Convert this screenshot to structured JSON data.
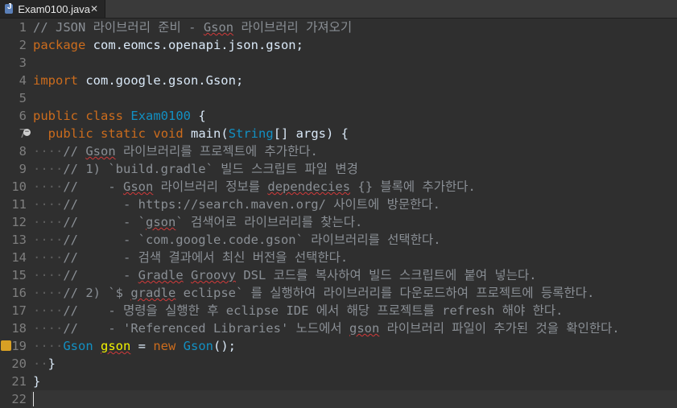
{
  "tab": {
    "title": "Exam0100.java",
    "close": "✕"
  },
  "lines": [
    {
      "n": "1",
      "segs": [
        [
          "cmt",
          "// JSON 라이브러리 준비 - "
        ],
        [
          "cmt sq",
          "Gson"
        ],
        [
          "cmt",
          " 라이브러리 가져오기"
        ]
      ]
    },
    {
      "n": "2",
      "segs": [
        [
          "kw",
          "package"
        ],
        [
          "plain",
          " com.eomcs.openapi.json.gson;"
        ]
      ]
    },
    {
      "n": "3",
      "segs": []
    },
    {
      "n": "4",
      "segs": [
        [
          "kw",
          "import"
        ],
        [
          "plain",
          " com.google.gson.Gson;"
        ]
      ]
    },
    {
      "n": "5",
      "segs": []
    },
    {
      "n": "6",
      "segs": [
        [
          "kw",
          "public"
        ],
        [
          "plain",
          " "
        ],
        [
          "kw",
          "class"
        ],
        [
          "plain",
          " "
        ],
        [
          "ty",
          "Exam0100"
        ],
        [
          "plain",
          " {"
        ]
      ]
    },
    {
      "n": "7",
      "segs": [
        [
          "plain",
          "  "
        ],
        [
          "kw",
          "public"
        ],
        [
          "plain",
          " "
        ],
        [
          "kw",
          "static"
        ],
        [
          "plain",
          " "
        ],
        [
          "kw",
          "void"
        ],
        [
          "plain",
          " main("
        ],
        [
          "ty",
          "String"
        ],
        [
          "plain",
          "[] args) {"
        ]
      ]
    },
    {
      "n": "8",
      "segs": [
        [
          "ws",
          "····"
        ],
        [
          "cmt",
          "// "
        ],
        [
          "cmt sq",
          "Gson"
        ],
        [
          "cmt",
          " 라이브러리를 프로젝트에 추가한다."
        ]
      ]
    },
    {
      "n": "9",
      "segs": [
        [
          "ws",
          "····"
        ],
        [
          "cmt",
          "// 1) `build.gradle` 빌드 스크립트 파일 변경"
        ]
      ]
    },
    {
      "n": "10",
      "segs": [
        [
          "ws",
          "····"
        ],
        [
          "cmt",
          "//    - "
        ],
        [
          "cmt sq",
          "Gson"
        ],
        [
          "cmt",
          " 라이브러리 정보를 "
        ],
        [
          "cmt sq",
          "dependecies"
        ],
        [
          "cmt",
          " {} 블록에 추가한다."
        ]
      ]
    },
    {
      "n": "11",
      "segs": [
        [
          "ws",
          "····"
        ],
        [
          "cmt",
          "//      - https://search.maven.org/ 사이트에 방문한다."
        ]
      ]
    },
    {
      "n": "12",
      "segs": [
        [
          "ws",
          "····"
        ],
        [
          "cmt",
          "//      - `"
        ],
        [
          "cmt sq",
          "gson"
        ],
        [
          "cmt",
          "` 검색어로 라이브러리를 찾는다."
        ]
      ]
    },
    {
      "n": "13",
      "segs": [
        [
          "ws",
          "····"
        ],
        [
          "cmt",
          "//      - `com.google.code.gson` 라이브러리를 선택한다."
        ]
      ]
    },
    {
      "n": "14",
      "segs": [
        [
          "ws",
          "····"
        ],
        [
          "cmt",
          "//      - 검색 결과에서 최신 버전을 선택한다."
        ]
      ]
    },
    {
      "n": "15",
      "segs": [
        [
          "ws",
          "····"
        ],
        [
          "cmt",
          "//      - "
        ],
        [
          "cmt sq",
          "Gradle"
        ],
        [
          "cmt",
          " "
        ],
        [
          "cmt sq",
          "Groovy"
        ],
        [
          "cmt",
          " DSL 코드를 복사하여 빌드 스크립트에 붙여 넣는다."
        ]
      ]
    },
    {
      "n": "16",
      "segs": [
        [
          "ws",
          "····"
        ],
        [
          "cmt",
          "// 2) `$ "
        ],
        [
          "cmt sq",
          "gradle"
        ],
        [
          "cmt",
          " eclipse` 를 실행하여 라이브러리를 다운로드하여 프로젝트에 등록한다."
        ]
      ]
    },
    {
      "n": "17",
      "segs": [
        [
          "ws",
          "····"
        ],
        [
          "cmt",
          "//    - 명령을 실행한 후 eclipse IDE 에서 해당 프로젝트를 refresh 해야 한다."
        ]
      ]
    },
    {
      "n": "18",
      "segs": [
        [
          "ws",
          "····"
        ],
        [
          "cmt",
          "//    - 'Referenced Libraries' 노드에서 "
        ],
        [
          "cmt sq",
          "gson"
        ],
        [
          "cmt",
          " 라이브러리 파일이 추가된 것을 확인한다."
        ]
      ]
    },
    {
      "n": "19",
      "segs": [
        [
          "ws",
          "····"
        ],
        [
          "ty",
          "Gson"
        ],
        [
          "plain",
          " "
        ],
        [
          "var sq",
          "gson"
        ],
        [
          "plain",
          " = "
        ],
        [
          "kw",
          "new"
        ],
        [
          "plain",
          " "
        ],
        [
          "ty",
          "Gson"
        ],
        [
          "plain",
          "();"
        ]
      ]
    },
    {
      "n": "20",
      "segs": [
        [
          "ws",
          "··"
        ],
        [
          "plain",
          "}"
        ]
      ]
    },
    {
      "n": "21",
      "segs": [
        [
          "plain",
          "}"
        ]
      ]
    },
    {
      "n": "22",
      "segs": []
    }
  ],
  "markers": {
    "fold_line": "7",
    "warning_line": "19",
    "current_line": "22"
  },
  "colors": {
    "keyword": "#cc6c1d",
    "type": "#1290c3",
    "comment": "#8a8f95",
    "variable": "#f2f200",
    "text": "#d9e8f7",
    "background": "#2f2f2f"
  }
}
